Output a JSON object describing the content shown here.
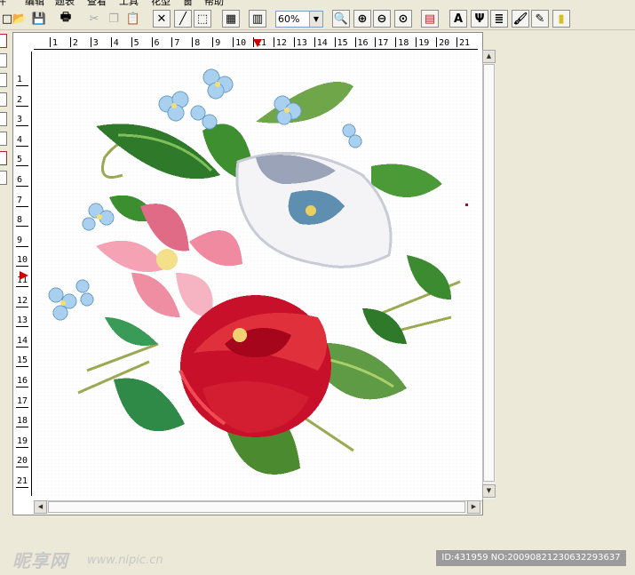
{
  "menu": [
    "件",
    "编辑",
    "题表",
    "查看",
    "工具",
    "花型",
    "窗",
    "帮助"
  ],
  "toolbar": {
    "zoom_value": "60%",
    "text_tool": "A",
    "buttons": [
      {
        "name": "new-icon",
        "glyph": "□"
      },
      {
        "name": "open-icon",
        "glyph": "📂"
      },
      {
        "name": "save-icon",
        "glyph": "💾"
      },
      {
        "name": "print-icon",
        "glyph": "🖶"
      },
      {
        "name": "cut-icon",
        "glyph": "✂"
      },
      {
        "name": "copy-icon",
        "glyph": "❐"
      },
      {
        "name": "paste-icon",
        "glyph": "📋"
      },
      {
        "name": "cross-stitch-icon",
        "glyph": "✕"
      },
      {
        "name": "line-icon",
        "glyph": "╱"
      },
      {
        "name": "select-rect-icon",
        "glyph": "⬚"
      },
      {
        "name": "grid-icon",
        "glyph": "▦"
      },
      {
        "name": "palette-icon",
        "glyph": "▥"
      },
      {
        "name": "zoom-window-icon",
        "glyph": "🔍"
      },
      {
        "name": "zoom-in-icon",
        "glyph": "⊕"
      },
      {
        "name": "zoom-out-icon",
        "glyph": "⊖"
      },
      {
        "name": "zoom-fit-icon",
        "glyph": "⊙"
      },
      {
        "name": "color-table-icon",
        "glyph": "▤"
      },
      {
        "name": "font-icon",
        "glyph": "Ψ"
      },
      {
        "name": "align-icon",
        "glyph": "≣"
      },
      {
        "name": "brush-icon",
        "glyph": "🖌"
      },
      {
        "name": "eyedropper-icon",
        "glyph": "✎"
      },
      {
        "name": "color-icon",
        "glyph": "▮"
      }
    ]
  },
  "ruler": {
    "horizontal": [
      "1",
      "2",
      "3",
      "4",
      "5",
      "6",
      "7",
      "8",
      "9",
      "10",
      "11",
      "12",
      "13",
      "14",
      "15",
      "16",
      "17",
      "18",
      "19",
      "20",
      "21"
    ],
    "vertical": [
      "1",
      "2",
      "3",
      "4",
      "5",
      "6",
      "7",
      "8",
      "9",
      "10",
      "11",
      "12",
      "13",
      "14",
      "15",
      "16",
      "17",
      "18",
      "19",
      "20",
      "21"
    ]
  },
  "watermark": {
    "logo": "昵享网",
    "site": "www.nipic.cn",
    "id_text": "ID:431959 NO:20090821230632293637"
  },
  "colors": {
    "chrome": "#ece9d8",
    "marker": "#d00000",
    "rose_red": "#d0202a",
    "pink": "#f08aa0",
    "leaf_green": "#3f8a32",
    "blue_flower": "#8fbfe0"
  }
}
